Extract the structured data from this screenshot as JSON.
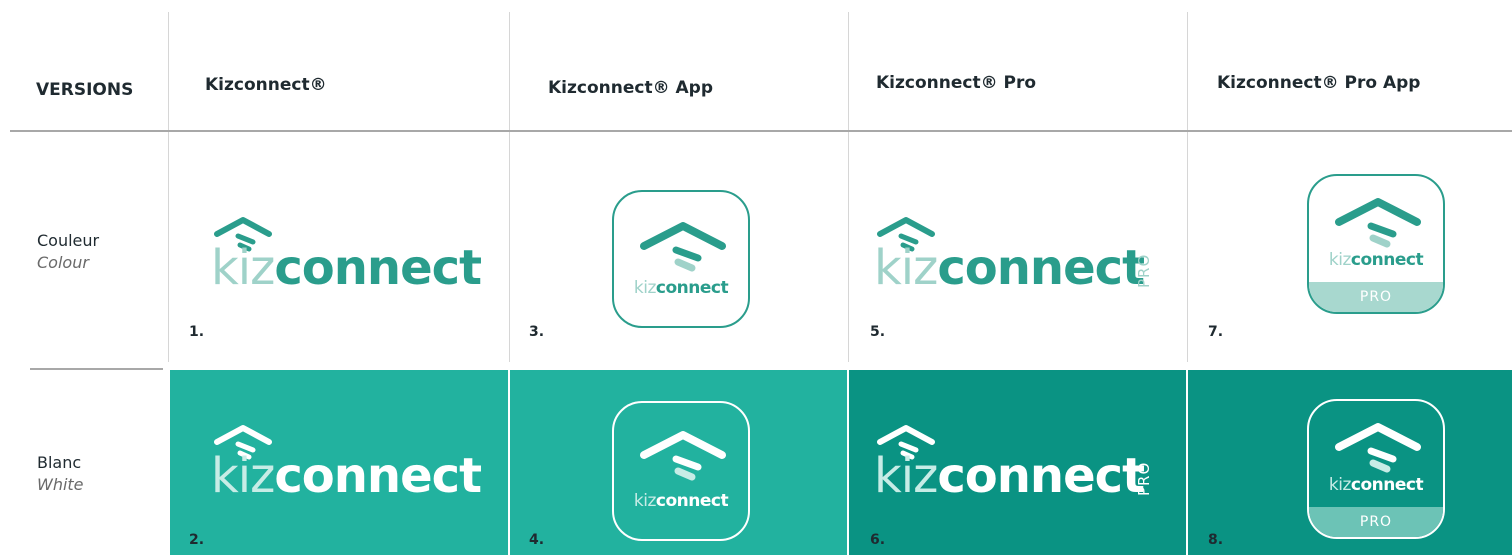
{
  "header": {
    "versions": "VERSIONS",
    "columns": [
      "Kizconnect®",
      "Kizconnect® App",
      "Kizconnect® Pro",
      "Kizconnect® Pro App"
    ]
  },
  "rows": [
    {
      "label": "Couleur",
      "translation": "Colour"
    },
    {
      "label": "Blanc",
      "translation": "White"
    }
  ],
  "numbers": [
    "1.",
    "2.",
    "3.",
    "4.",
    "5.",
    "6.",
    "7.",
    "8."
  ],
  "logo": {
    "prefix": "kiz",
    "suffix": "connect",
    "pro": "PRO"
  },
  "colors": {
    "teal_primary": "#2a9d8c",
    "teal_light": "#9fd2c9",
    "teal_bg_light": "#22b29f",
    "teal_bg_dark": "#0a9383",
    "pro_bar": "#a8d8cf"
  }
}
